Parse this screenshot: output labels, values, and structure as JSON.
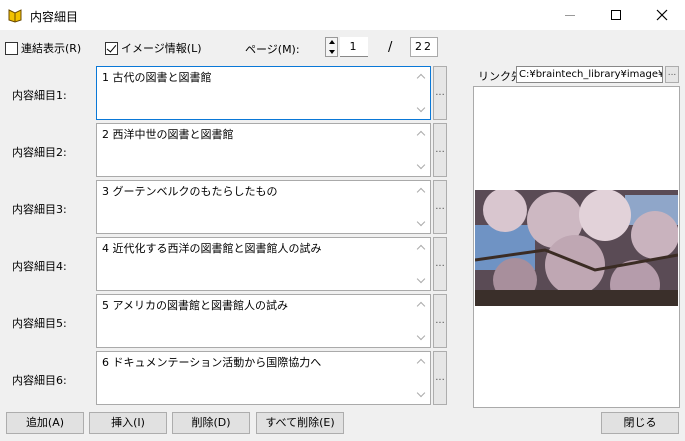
{
  "window": {
    "title": "内容細目",
    "icon": "book-icon"
  },
  "options": {
    "link_display": {
      "label": "連結表示(R)",
      "checked": false
    },
    "image_info": {
      "label": "イメージ情報(L)",
      "checked": true
    }
  },
  "page": {
    "label": "ページ(M):",
    "current": "1",
    "separator": "/",
    "total": "22"
  },
  "items": [
    {
      "label": "内容細目1:",
      "text": "1 古代の図書と図書館"
    },
    {
      "label": "内容細目2:",
      "text": "2 西洋中世の図書と図書館"
    },
    {
      "label": "内容細目3:",
      "text": "3 グーテンベルクのもたらしたもの"
    },
    {
      "label": "内容細目4:",
      "text": "4 近代化する西洋の図書館と図書館人の試み"
    },
    {
      "label": "内容細目5:",
      "text": "5 アメリカの図書館と図書館人の試み"
    },
    {
      "label": "内容細目6:",
      "text": "6 ドキュメンテーション活動から国際協力へ"
    }
  ],
  "item_button_label": "...",
  "link": {
    "label": "リンク先:",
    "value": "C:¥braintech_library¥image¥l",
    "button_label": "..."
  },
  "buttons": {
    "add": "追加(A)",
    "insert": "挿入(I)",
    "delete": "削除(D)",
    "delete_all": "すべて削除(E)",
    "close": "閉じる"
  }
}
